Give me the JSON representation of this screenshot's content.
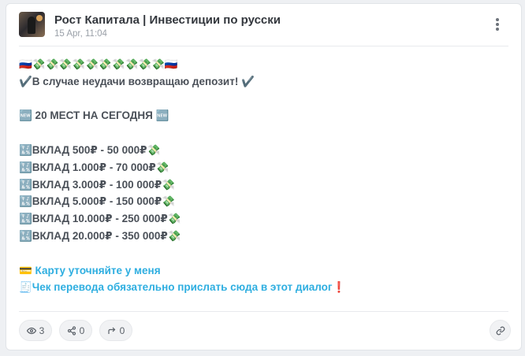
{
  "post": {
    "channel_title": "Рост Капитала | Инвестиции по русски",
    "date": "15 Apr, 11:04",
    "lines": [
      "🇷🇺💸💸💸💸💸💸💸💸💸💸🇷🇺",
      "✔️В случае неудачи возвращаю депозит! ✔️",
      "",
      "🆕 20 МЕСТ НА СЕГОДНЯ 🆕",
      "",
      "🔣ВКЛАД 500₽ - 50 000₽💸",
      "🔣ВКЛАД 1.000₽ - 70 000₽💸",
      "🔣ВКЛАД 3.000₽ - 100 000₽💸",
      "🔣ВКЛАД 5.000₽ - 150 000₽💸",
      "🔣ВКЛАД 10.000₽ - 250 000₽💸",
      "🔣ВКЛАД 20.000₽ - 350 000₽💸",
      ""
    ],
    "link_lines": [
      "💳 Карту уточняйте у меня",
      "🧾Чек перевода обязательно прислать сюда в этот диалог❗"
    ]
  },
  "footer": {
    "views": "3",
    "shares": "0",
    "forwards": "0",
    "icons": [
      "eye-icon",
      "share-icon",
      "forward-icon",
      "link-icon"
    ]
  },
  "colors": {
    "link": "#2eaee0",
    "text": "#4a5058",
    "title": "#33373d",
    "date": "#9aa0a8"
  }
}
